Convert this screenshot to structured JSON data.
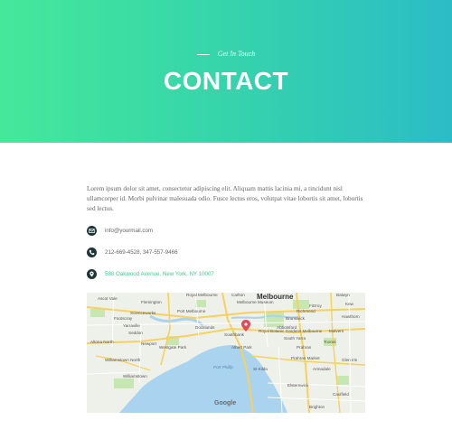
{
  "header": {
    "eyebrow": "Get In Touch",
    "title": "CONTACT"
  },
  "contact": {
    "intro": "Lorem ipsum dolor sit amet, consectetur adipiscing elit. Aliquam mattis lacinia mi, a tincidunt nisl ullamcorper id. Morbi pulvinar malesuada odio. Fusce lectus eros, volutpat vitae lobortis sit amet, lobortis sed lectus.",
    "email": "info@yourmail.com",
    "phone": "212-669-4528, 347-557-9466",
    "address": "588 Oakwood Avenue, New York, NY 10007"
  },
  "map": {
    "city": "Melbourne",
    "places": [
      "Brunswick",
      "Fitzroy",
      "Kew",
      "Balwyn",
      "Ascot Vale",
      "Flemington",
      "Port Melbourne",
      "Footscray",
      "Richmond",
      "Hawthorn",
      "South Yarra",
      "Malvern",
      "Toorak",
      "Newport",
      "Altona North",
      "Williamstown",
      "Williamstown North",
      "St Kilda",
      "Prahran",
      "Armadale",
      "Caulfield",
      "Elsternwick",
      "Glen Iris",
      "Royal Botanic Gardens Melbourne",
      "Docklands",
      "Southbank",
      "Albert Park",
      "Brighton",
      "Seddon",
      "Yarraville",
      "Royal Melbourne",
      "Westgate Park",
      "Scienceworks",
      "Melbourne Museum",
      "Carlton",
      "Abbotsford",
      "Prahran Market",
      "Port Phillip Bay"
    ],
    "water_label": "Port Phillip",
    "attribution": "Google"
  },
  "colors": {
    "gradient_start": "#45e89a",
    "gradient_end": "#2bbcc6",
    "icon_bg": "#1f3536",
    "accent": "#3fcb8f",
    "text": "#666666"
  }
}
